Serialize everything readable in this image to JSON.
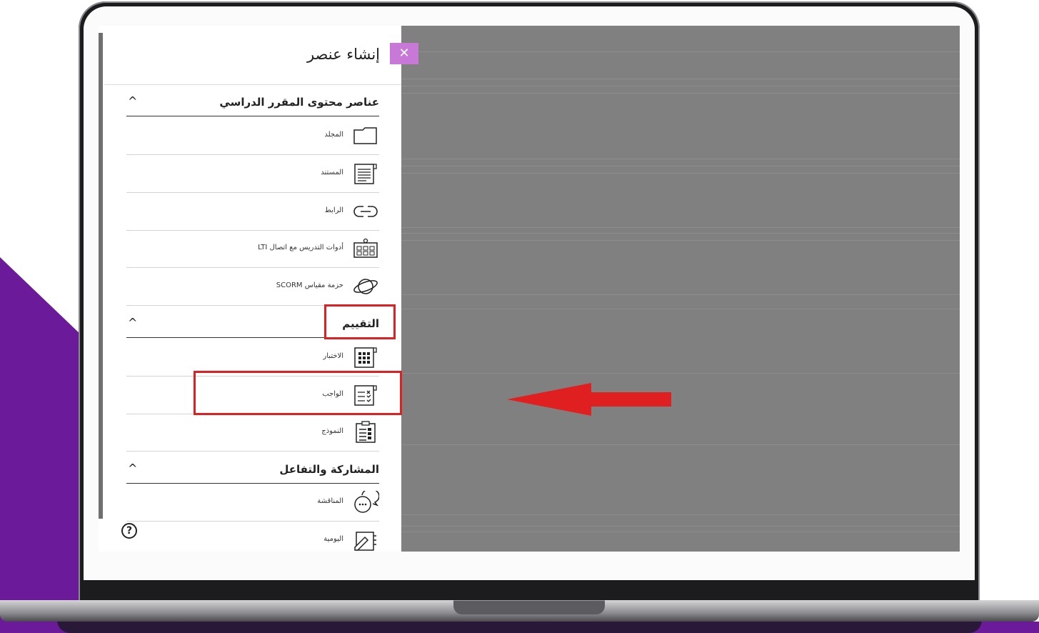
{
  "panel": {
    "title": "إنشاء عنصر",
    "close_label": "✕",
    "help_label": "?"
  },
  "sections": [
    {
      "label": "عناصر محتوى المقرر الدراسي",
      "items": [
        {
          "label": "المجلد",
          "icon": "folder-icon"
        },
        {
          "label": "المستند",
          "icon": "document-icon"
        },
        {
          "label": "الرابط",
          "icon": "link-icon"
        },
        {
          "label": "أدوات التدريس مع اتصال LTI",
          "icon": "lti-tools-icon"
        },
        {
          "label": "حزمة مقياس SCORM",
          "icon": "scorm-package-icon"
        }
      ]
    },
    {
      "label": "التقييم",
      "items": [
        {
          "label": "الاختبار",
          "icon": "test-icon"
        },
        {
          "label": "الواجب",
          "icon": "assignment-icon"
        },
        {
          "label": "النموذج",
          "icon": "form-icon"
        }
      ]
    },
    {
      "label": "المشاركة والتفاعل",
      "items": [
        {
          "label": "المناقشة",
          "icon": "discussion-icon"
        },
        {
          "label": "اليومية",
          "icon": "journal-icon"
        }
      ]
    }
  ],
  "colors": {
    "purple": "#6b1a9a",
    "close_button": "#c879d8",
    "highlight": "#e02020",
    "overlay": "#808080"
  }
}
